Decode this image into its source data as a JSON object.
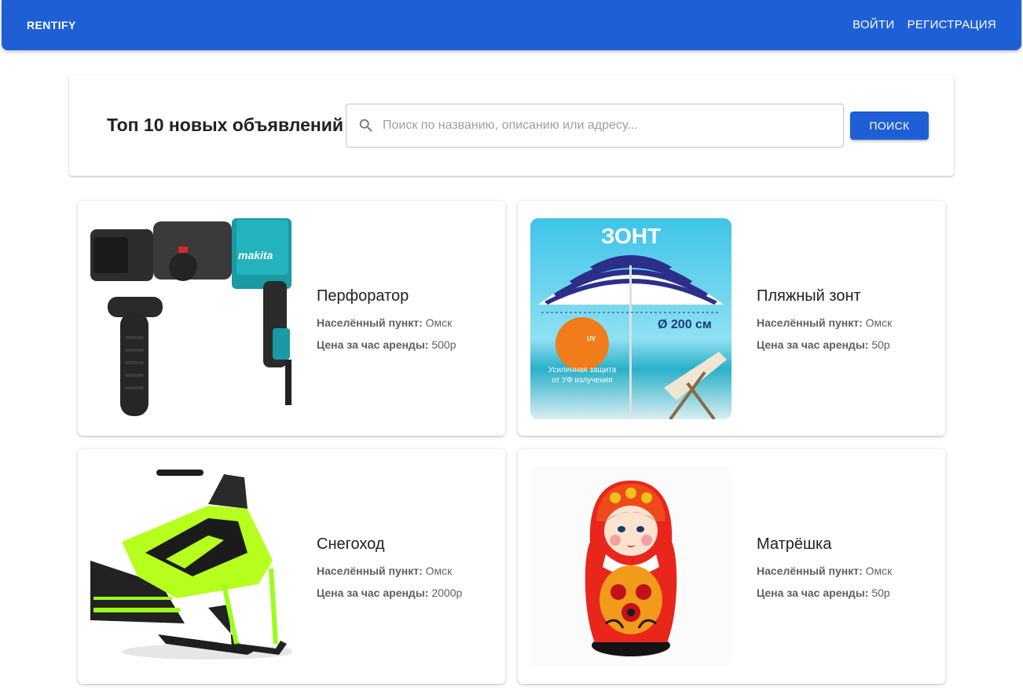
{
  "app": {
    "brand": "RENTIFY",
    "nav": {
      "login": "ВОЙТИ",
      "register": "РЕГИСТРАЦИЯ"
    }
  },
  "search": {
    "title": "Топ 10 новых объявлений",
    "placeholder": "Поиск по названию, описанию или адресу...",
    "value": "",
    "button": "ПОИСК"
  },
  "labels": {
    "city": "Населённый пункт:",
    "price": "Цена за час аренды:"
  },
  "listings": [
    {
      "title": "Перфоратор",
      "city": "Омск",
      "price": "500р",
      "image": "hammer-drill-image"
    },
    {
      "title": "Пляжный зонт",
      "city": "Омск",
      "price": "50р",
      "image": "beach-umbrella-image",
      "image_text": {
        "heading": "ЗОНТ",
        "size": "Ø 200 см",
        "uv": "UV",
        "caption_1": "Усиленная защита",
        "caption_2": "от УФ излучения"
      }
    },
    {
      "title": "Снегоход",
      "city": "Омск",
      "price": "2000р",
      "image": "snowmobile-image"
    },
    {
      "title": "Матрёшка",
      "city": "Омск",
      "price": "50р",
      "image": "matryoshka-image"
    }
  ],
  "colors": {
    "primary": "#1f5fd6",
    "text": "#212121",
    "muted": "#616161"
  }
}
